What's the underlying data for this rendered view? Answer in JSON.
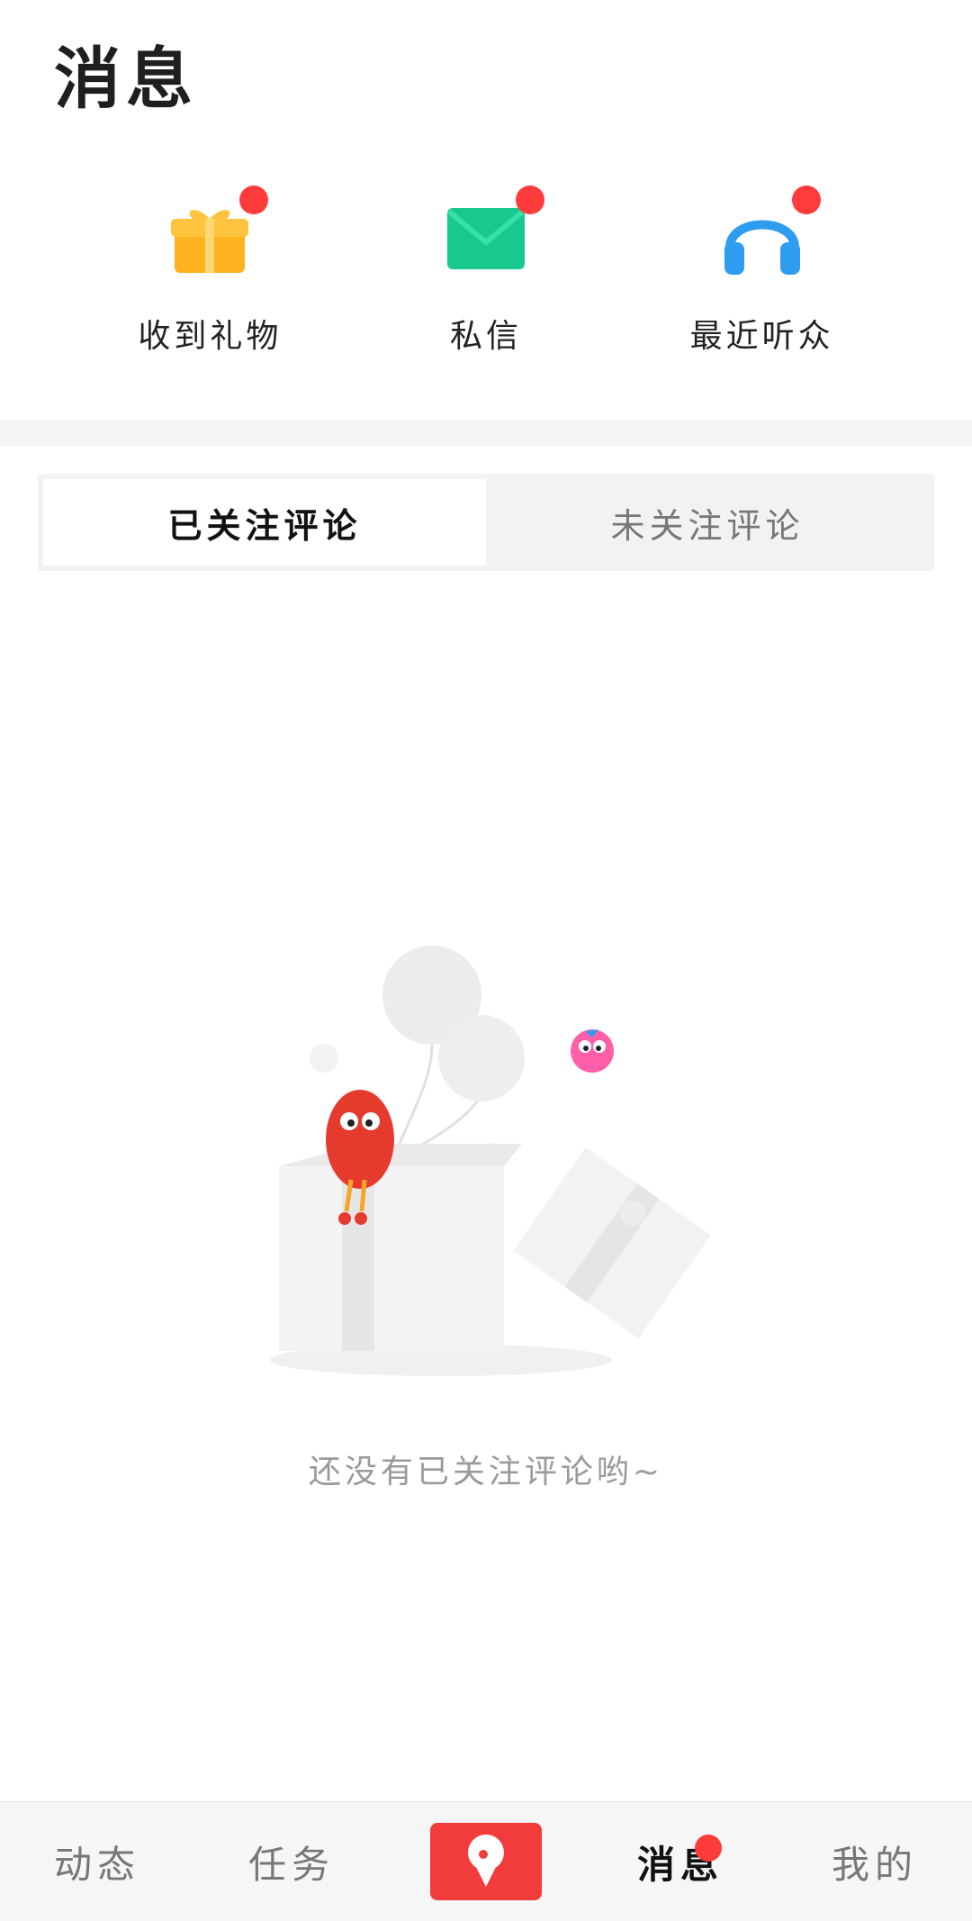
{
  "page": {
    "title": "消息"
  },
  "quick_entries": [
    {
      "label": "收到礼物",
      "icon": "gift-icon",
      "badge": true,
      "color": "#FFB21F"
    },
    {
      "label": "私信",
      "icon": "mail-icon",
      "badge": true,
      "color": "#18C98F"
    },
    {
      "label": "最近听众",
      "icon": "headphones-icon",
      "badge": true,
      "color": "#2E9DF0"
    }
  ],
  "tabs": [
    {
      "label": "已关注评论",
      "active": true
    },
    {
      "label": "未关注评论",
      "active": false
    }
  ],
  "empty_state": {
    "text": "还没有已关注评论哟~"
  },
  "bottom_nav": [
    {
      "label": "动态",
      "active": false
    },
    {
      "label": "任务",
      "active": false
    },
    {
      "label": "",
      "icon": "record-icon",
      "active": false
    },
    {
      "label": "消息",
      "active": true,
      "badge": true
    },
    {
      "label": "我的",
      "active": false
    }
  ],
  "colors": {
    "accent": "#F23C3C",
    "badge": "#FF3B3B",
    "muted_text": "#9A9A9A"
  }
}
